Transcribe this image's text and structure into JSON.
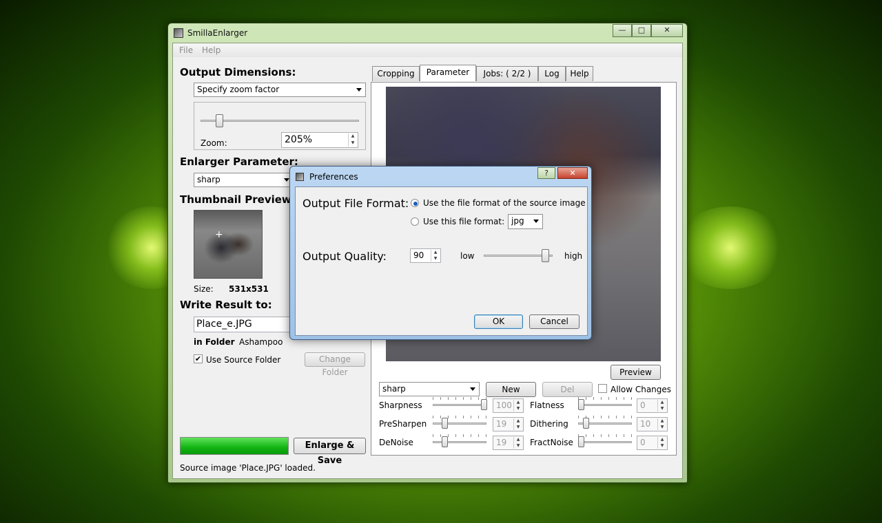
{
  "window": {
    "title": "SmillaEnlarger",
    "caption_min": "—",
    "caption_max": "□",
    "caption_close": "✕"
  },
  "menu": [
    "File",
    "Help"
  ],
  "left": {
    "output_dimensions_title": "Output Dimensions:",
    "dimension_mode": "Specify zoom factor",
    "zoom_label": "Zoom:",
    "zoom_value": "205%",
    "zoom_fraction": 0.1,
    "enlarger_parameter_title": "Enlarger Parameter:",
    "preset": "sharp",
    "thumbnail_title": "Thumbnail Preview:",
    "size_label": "Size:",
    "size_value": "531x531",
    "write_result_title": "Write Result to:",
    "output_filename": "Place_e.JPG",
    "in_folder_label": "in Folder",
    "folder_value": "Ashampoo",
    "use_source_folder_label": "Use Source Folder",
    "use_source_folder_checked": true,
    "change_folder_label": "Change Folder",
    "enlarge_save_label": "Enlarge & Save",
    "progress": 1.0
  },
  "tabs": [
    "Cropping",
    "Parameter",
    "Jobs: ( 2/2 )",
    "Log",
    "Help"
  ],
  "active_tab": "Parameter",
  "preview_button": "Preview",
  "params": {
    "preset": "sharp",
    "new_label": "New",
    "del_label": "Del",
    "allow_changes_label": "Allow Changes",
    "left": [
      {
        "name": "Sharpness",
        "value": "100",
        "fraction": 1.0
      },
      {
        "name": "PreSharpen",
        "value": "19",
        "fraction": 0.19
      },
      {
        "name": "DeNoise",
        "value": "19",
        "fraction": 0.19
      }
    ],
    "right": [
      {
        "name": "Flatness",
        "value": "0",
        "fraction": 0.0
      },
      {
        "name": "Dithering",
        "value": "10",
        "fraction": 0.1
      },
      {
        "name": "FractNoise",
        "value": "0",
        "fraction": 0.0
      }
    ]
  },
  "status": "Source image 'Place.JPG' loaded.",
  "dialog": {
    "title": "Preferences",
    "help_btn": "?",
    "close_btn": "✕",
    "output_format_label": "Output File Format:",
    "radio_source": "Use the file format of the source image",
    "radio_this": "Use this file format:",
    "format_value": "jpg",
    "quality_label": "Output Quality:",
    "quality_value": "90",
    "quality_fraction": 0.9,
    "low_label": "low",
    "high_label": "high",
    "ok_label": "OK",
    "cancel_label": "Cancel"
  }
}
